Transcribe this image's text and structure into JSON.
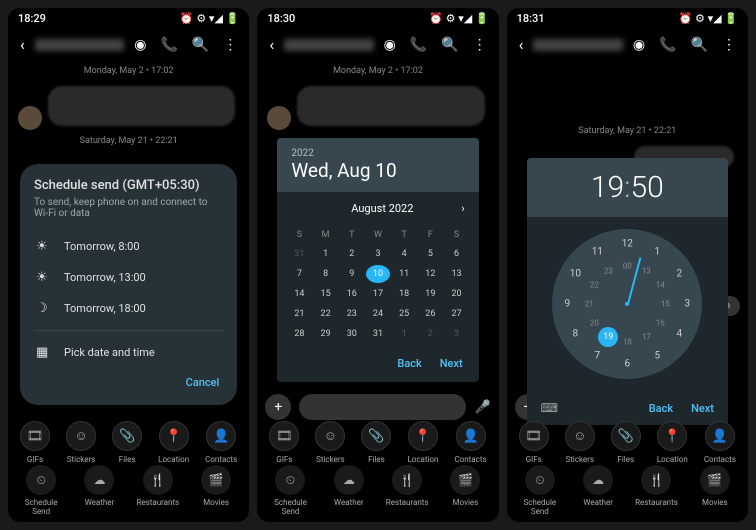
{
  "screens": [
    {
      "time": "18:29",
      "ts1": "Monday, May 2 • 17:02",
      "ts2": "Saturday, May 21 • 22:21"
    },
    {
      "time": "18:30",
      "ts1": "Monday, May 2 • 17:02"
    },
    {
      "time": "18:31",
      "ts2": "Saturday, May 21 • 22:21"
    }
  ],
  "dialog": {
    "title": "Schedule send (GMT+05:30)",
    "subtitle": "To send, keep phone on and connect to Wi-Fi or data",
    "opts": [
      "Tomorrow, 8:00",
      "Tomorrow, 13:00",
      "Tomorrow, 18:00"
    ],
    "pick": "Pick date and time",
    "cancel": "Cancel"
  },
  "strip": [
    "GIFs",
    "Stickers",
    "Files",
    "Location",
    "Contacts"
  ],
  "strip_icons": [
    "🎞",
    "☺",
    "📎",
    "📍",
    "👤"
  ],
  "actions": [
    "Schedule Send",
    "Weather",
    "Restaurants",
    "Movies"
  ],
  "action_icons": [
    "⏲",
    "☁",
    "🍴",
    "🎬"
  ],
  "datepicker": {
    "year": "2022",
    "date": "Wed, Aug 10",
    "month": "August 2022",
    "dh": [
      "S",
      "M",
      "T",
      "W",
      "T",
      "F",
      "S"
    ],
    "prev": [
      "31"
    ],
    "days": [
      "1",
      "2",
      "3",
      "4",
      "5",
      "6",
      "7",
      "8",
      "9",
      "10",
      "11",
      "12",
      "13",
      "14",
      "15",
      "16",
      "17",
      "18",
      "19",
      "20",
      "21",
      "22",
      "23",
      "24",
      "25",
      "26",
      "27",
      "28",
      "29",
      "30",
      "31"
    ],
    "next": [
      "1",
      "2",
      "3"
    ],
    "sel": "10",
    "back": "Back",
    "nxt": "Next"
  },
  "timepicker": {
    "h": "19",
    "m": "50",
    "back": "Back",
    "nxt": "Next"
  },
  "photo": "photo",
  "status_icons": "⏰ ⚙ ▾◢ 🔋"
}
